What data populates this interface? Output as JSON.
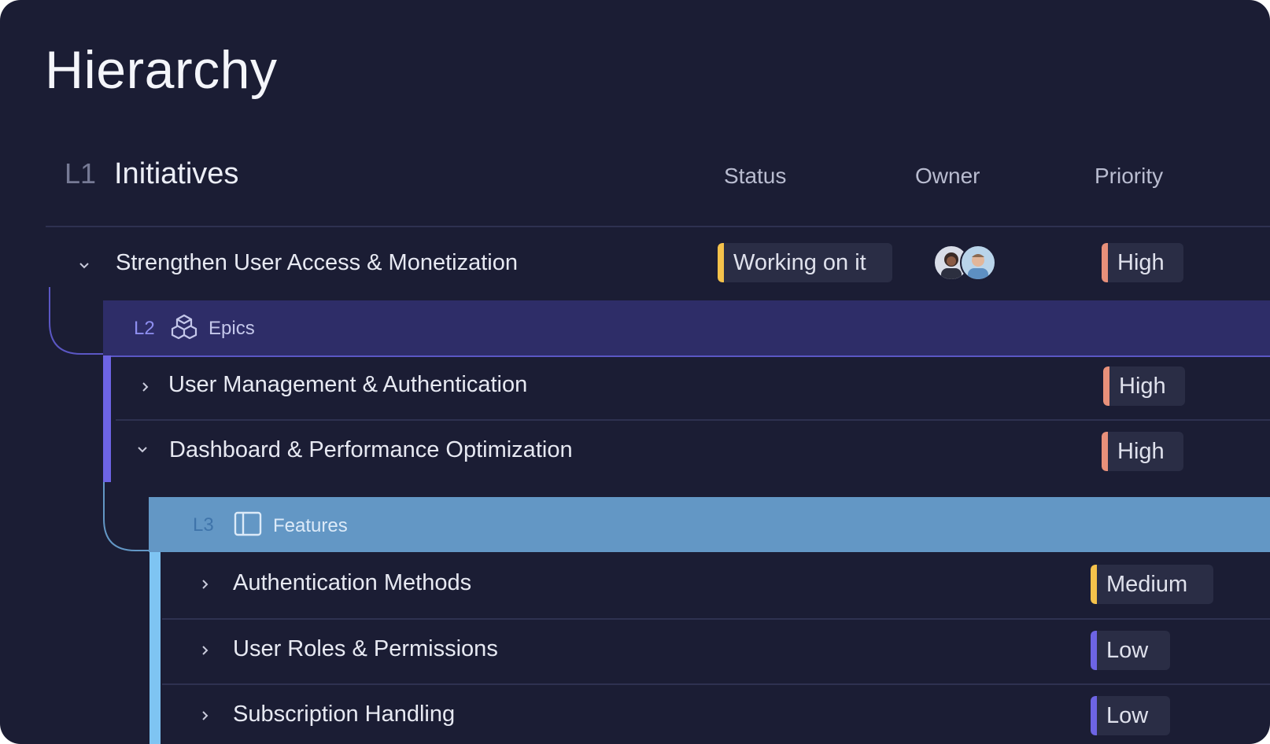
{
  "page": {
    "title": "Hierarchy"
  },
  "level1": {
    "tag": "L1",
    "title": "Initiatives",
    "columns": {
      "status": "Status",
      "owner": "Owner",
      "priority": "Priority"
    },
    "items": [
      {
        "label": "Strengthen User Access & Monetization",
        "status": "Working on it",
        "status_color": "#f5c24b",
        "priority": "High",
        "priority_color": "#e8907a"
      }
    ]
  },
  "level2": {
    "tag": "L2",
    "label": "Epics",
    "accent": "#6d64e4",
    "items": [
      {
        "label": "User Management & Authentication",
        "priority": "High",
        "priority_color": "#e8907a"
      },
      {
        "label": "Dashboard & Performance Optimization",
        "priority": "High",
        "priority_color": "#e8907a"
      }
    ]
  },
  "level3": {
    "tag": "L3",
    "label": "Features",
    "accent": "#7ec4f2",
    "items": [
      {
        "label": "Authentication Methods",
        "priority": "Medium",
        "priority_color": "#f5c24b"
      },
      {
        "label": "User Roles & Permissions",
        "priority": "Low",
        "priority_color": "#6d64e4"
      },
      {
        "label": "Subscription Handling",
        "priority": "Low",
        "priority_color": "#6d64e4"
      }
    ]
  },
  "icons": {
    "expanded": "chevron-down-icon",
    "collapsed": "chevron-right-icon",
    "epics": "boxes-icon",
    "features": "sidebar-panel-icon"
  }
}
